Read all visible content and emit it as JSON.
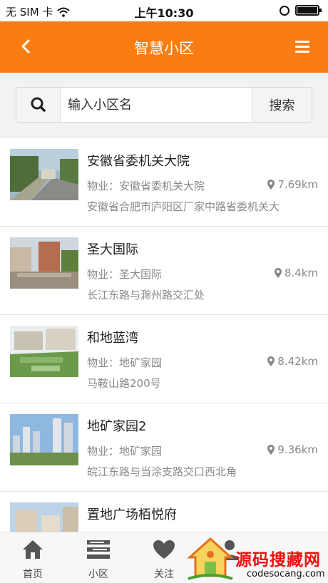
{
  "status_bar": {
    "carrier": "无 SIM 卡",
    "time": "上午10:30"
  },
  "header": {
    "title": "智慧小区",
    "accent_color": "#fa7d13"
  },
  "search": {
    "placeholder": "输入小区名",
    "button_label": "搜索"
  },
  "communities": [
    {
      "name": "安徽省委机关大院",
      "management": "物业：安徽省委机关大院",
      "distance": "7.69km",
      "address": "安徽省合肥市庐阳区厂家中路省委机关大"
    },
    {
      "name": "圣大国际",
      "management": "物业：圣大国际",
      "distance": "8.4km",
      "address": "长江东路与滁州路交汇处"
    },
    {
      "name": "和地蓝湾",
      "management": "物业：地矿家园",
      "distance": "8.42km",
      "address": "马鞍山路200号"
    },
    {
      "name": "地矿家园2",
      "management": "物业：地矿家园",
      "distance": "9.36km",
      "address": "皖江东路与当涂支路交口西北角"
    },
    {
      "name": "置地广场栢悦府",
      "management": "",
      "distance": "",
      "address": ""
    }
  ],
  "tabbar": {
    "items": [
      {
        "label": "首页",
        "icon": "home-icon"
      },
      {
        "label": "小区",
        "icon": "list-icon"
      },
      {
        "label": "关注",
        "icon": "heart-icon"
      },
      {
        "label": "",
        "icon": "user-icon"
      }
    ]
  },
  "watermark": {
    "brand": "源码搜藏网",
    "url": "codesocang.com"
  }
}
